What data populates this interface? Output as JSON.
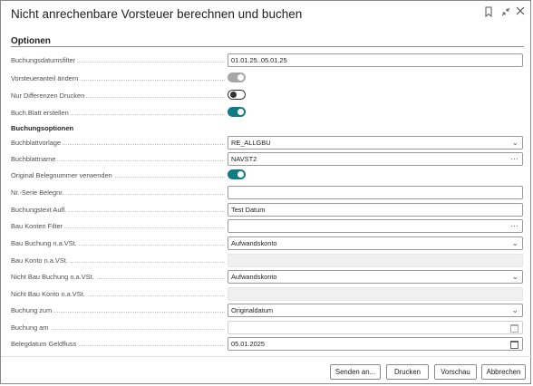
{
  "dialog": {
    "title": "Nicht anrechenbare Vorsteuer berechnen und buchen",
    "icons": [
      "bookmark-icon",
      "collapse-icon",
      "close-icon"
    ]
  },
  "options": {
    "section_title": "Optionen",
    "fields": {
      "datumsfilter": {
        "label": "Buchungsdatumsfilter",
        "value": "01.01.25..05.01.25"
      },
      "vorsteueranteil": {
        "label": "Vorsteueranteil ändern",
        "state": "on-disabled"
      },
      "nur_differenzen": {
        "label": "Nur Differenzen Drucken",
        "state": "off"
      },
      "buch_blatt": {
        "label": "Buch.Blatt erstellen",
        "state": "on"
      }
    }
  },
  "buchungsoptionen": {
    "group_title": "Buchungsoptionen",
    "fields": {
      "buchblattvorlage": {
        "label": "Buchblattvorlage",
        "value": "RE_ALLGBU"
      },
      "buchblattname": {
        "label": "Buchblattname",
        "value": "NAVST2"
      },
      "original_belegnummer": {
        "label": "Original Belegnummer verwenden",
        "state": "on"
      },
      "nr_serie": {
        "label": "Nr.-Serie Belegnr.",
        "value": ""
      },
      "buchungstext": {
        "label": "Buchungstext Aufl.",
        "value": "Test Datum"
      },
      "bau_konten_filter": {
        "label": "Bau Konten Filter",
        "value": ""
      },
      "bau_buchung": {
        "label": "Bau Buchung n.a.VSt.",
        "value": "Aufwandskonto"
      },
      "bau_konto": {
        "label": "Bau Konto n.a.VSt.",
        "value": ""
      },
      "nicht_bau_buchung": {
        "label": "Nicht Bau Buchung n.a.VSt.",
        "value": "Aufwandskonto"
      },
      "nicht_bau_konto": {
        "label": "Nicht Bau Konto n.a.VSt.",
        "value": ""
      },
      "buchung_zum": {
        "label": "Buchung zum",
        "value": "Originaldatum"
      },
      "buchung_am": {
        "label": "Buchung am",
        "value": ""
      },
      "belegdatum": {
        "label": "Belegdatum Geldfluss",
        "value": "05.01.2025"
      }
    }
  },
  "footer": {
    "send": "Senden an...",
    "print": "Drucken",
    "preview": "Vorschau",
    "cancel": "Abbrechen"
  },
  "colors": {
    "accent": "#0f7b84",
    "toggle_disabled": "#a6a6a6"
  }
}
